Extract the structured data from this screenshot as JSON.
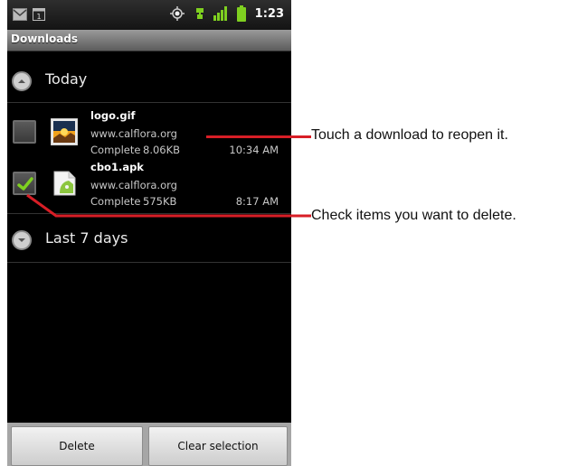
{
  "status_bar": {
    "time": "1:23",
    "icons": [
      "gmail-icon",
      "calendar-icon",
      "gps-icon",
      "usb-debug-icon",
      "signal-icon",
      "battery-icon"
    ]
  },
  "title_bar": {
    "title": "Downloads"
  },
  "groups": [
    {
      "label": "Today",
      "state": "expanded"
    },
    {
      "label": "Last 7 days",
      "state": "collapsed"
    }
  ],
  "downloads": [
    {
      "name": "logo.gif",
      "site": "www.calflora.org",
      "status": "Complete",
      "size": "8.06KB",
      "time": "10:34 AM",
      "checked": false,
      "icon": "image-file-icon"
    },
    {
      "name": "cbo1.apk",
      "site": "www.calflora.org",
      "status": "Complete",
      "size": "575KB",
      "time": "8:17 AM",
      "checked": true,
      "icon": "apk-file-icon"
    }
  ],
  "buttons": {
    "delete": "Delete",
    "clear_selection": "Clear selection"
  },
  "callouts": [
    {
      "text": "Touch a download to reopen it."
    },
    {
      "text": "Check items you want to delete."
    }
  ],
  "colors": {
    "callout_line": "#d81e26",
    "checkmark": "#7fd020"
  }
}
